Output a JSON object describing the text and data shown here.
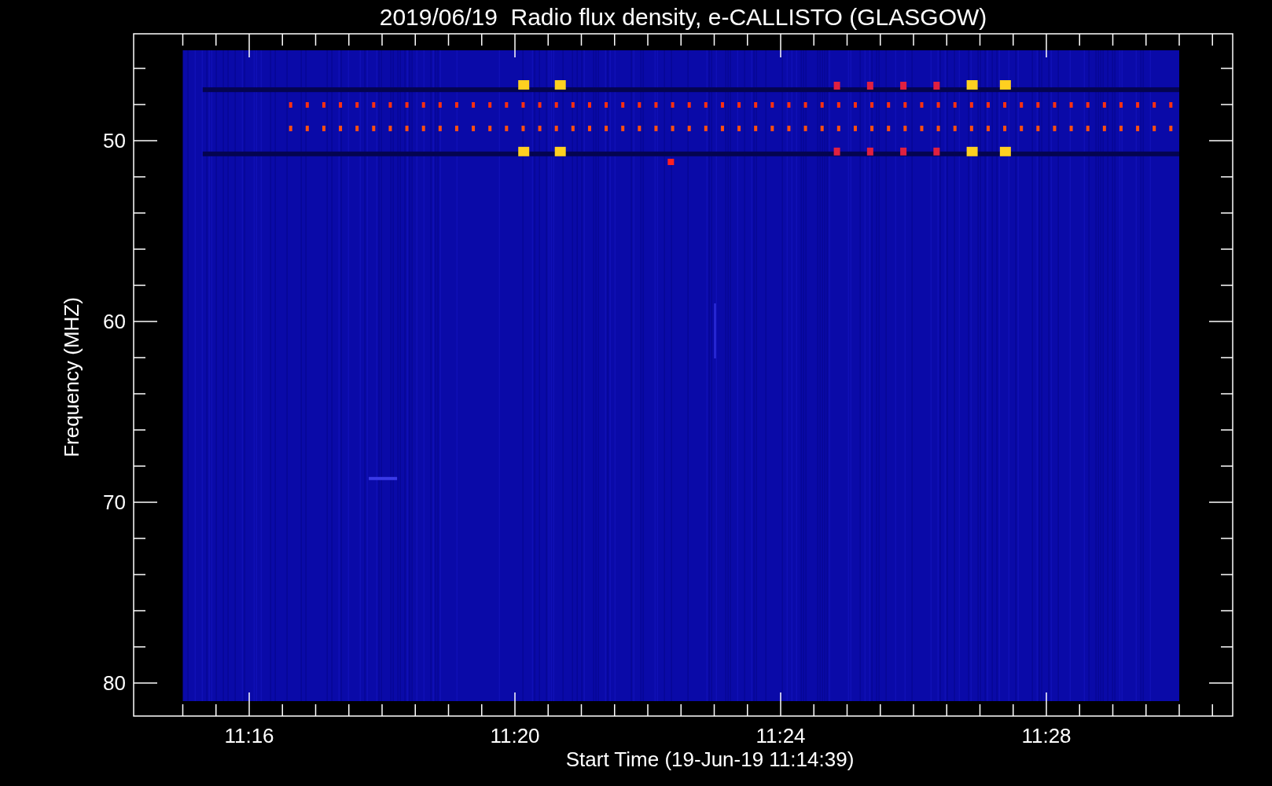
{
  "title": "2019/06/19  Radio flux density, e-CALLISTO (GLASGOW)",
  "y_axis": {
    "label": "Frequency (MHZ)",
    "ticks": [
      "50",
      "60",
      "70",
      "80"
    ]
  },
  "x_axis": {
    "label": "Start Time (19-Jun-19 11:14:39)",
    "ticks": [
      "11:16",
      "11:20",
      "11:24",
      "11:28"
    ]
  }
}
